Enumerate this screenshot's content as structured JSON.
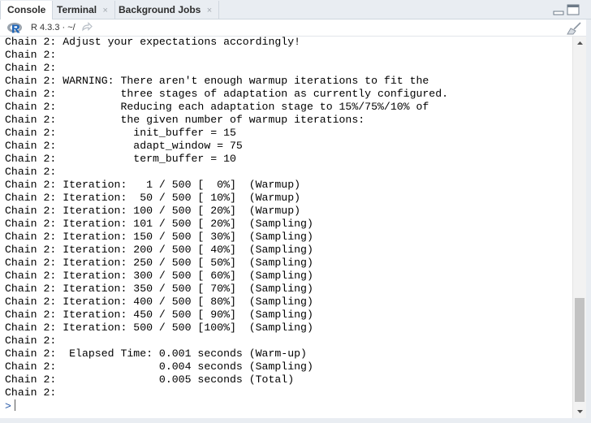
{
  "tabs": [
    {
      "label": "Console",
      "active": true
    },
    {
      "label": "Terminal",
      "close": "×"
    },
    {
      "label": "Background Jobs",
      "close": "×"
    }
  ],
  "toolbar": {
    "r_version": "R 4.3.3 · ~/",
    "logo_icon": "r-logo-icon",
    "path_icon": "path-link-icon",
    "clear_icon": "broom-icon"
  },
  "console": {
    "lines": [
      "Chain 2: Adjust your expectations accordingly!",
      "Chain 2:",
      "Chain 2:",
      "Chain 2: WARNING: There aren't enough warmup iterations to fit the",
      "Chain 2:          three stages of adaptation as currently configured.",
      "Chain 2:          Reducing each adaptation stage to 15%/75%/10% of",
      "Chain 2:          the given number of warmup iterations:",
      "Chain 2:            init_buffer = 15",
      "Chain 2:            adapt_window = 75",
      "Chain 2:            term_buffer = 10",
      "Chain 2:",
      "Chain 2: Iteration:   1 / 500 [  0%]  (Warmup)",
      "Chain 2: Iteration:  50 / 500 [ 10%]  (Warmup)",
      "Chain 2: Iteration: 100 / 500 [ 20%]  (Warmup)",
      "Chain 2: Iteration: 101 / 500 [ 20%]  (Sampling)",
      "Chain 2: Iteration: 150 / 500 [ 30%]  (Sampling)",
      "Chain 2: Iteration: 200 / 500 [ 40%]  (Sampling)",
      "Chain 2: Iteration: 250 / 500 [ 50%]  (Sampling)",
      "Chain 2: Iteration: 300 / 500 [ 60%]  (Sampling)",
      "Chain 2: Iteration: 350 / 500 [ 70%]  (Sampling)",
      "Chain 2: Iteration: 400 / 500 [ 80%]  (Sampling)",
      "Chain 2: Iteration: 450 / 500 [ 90%]  (Sampling)",
      "Chain 2: Iteration: 500 / 500 [100%]  (Sampling)",
      "Chain 2:",
      "Chain 2:  Elapsed Time: 0.001 seconds (Warm-up)",
      "Chain 2:                0.004 seconds (Sampling)",
      "Chain 2:                0.005 seconds (Total)",
      "Chain 2:"
    ],
    "prompt": ">"
  },
  "colors": {
    "tabbar_bg": "#e9edf2",
    "prompt": "#2657a6",
    "text": "#000000"
  }
}
